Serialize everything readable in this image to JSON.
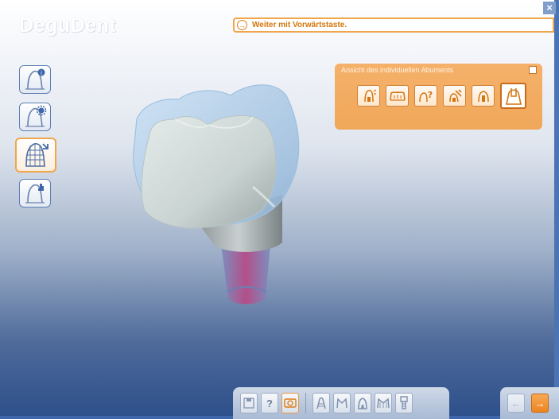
{
  "app": {
    "logo_text": "DeguDent",
    "close_glyph": "×"
  },
  "message": {
    "arrow_glyph": "→",
    "text": "Weiter mit Vorwärtstaste."
  },
  "sidebar": {
    "items": [
      {
        "name": "tooth-info",
        "icon": "tooth-info-icon",
        "active": false
      },
      {
        "name": "tooth-settings",
        "icon": "tooth-gear-icon",
        "active": false
      },
      {
        "name": "tooth-mesh",
        "icon": "tooth-mesh-icon",
        "active": true
      },
      {
        "name": "tooth-edit",
        "icon": "tooth-hand-icon",
        "active": false
      }
    ]
  },
  "view_panel": {
    "title": "Ansicht des individuellen Abuments",
    "buttons": [
      {
        "icon": "abutment-side-icon"
      },
      {
        "icon": "jaw-icon"
      },
      {
        "icon": "abutment-question-icon"
      },
      {
        "icon": "abutment-tool-icon"
      },
      {
        "icon": "abutment-front-icon"
      },
      {
        "icon": "abutment-individual-icon",
        "active": true
      }
    ]
  },
  "toolbar": {
    "buttons": [
      {
        "name": "save",
        "icon": "save-icon",
        "glyph": ""
      },
      {
        "name": "help",
        "icon": "help-icon",
        "glyph": "?"
      },
      {
        "name": "screenshot",
        "icon": "camera-icon",
        "glyph": ""
      },
      {
        "name": "view-a",
        "icon": "tooth-a-icon",
        "glyph": ""
      },
      {
        "name": "view-m",
        "icon": "tooth-m-icon",
        "glyph": ""
      },
      {
        "name": "view-crown",
        "icon": "tooth-crown-icon",
        "glyph": ""
      },
      {
        "name": "view-m-mesh",
        "icon": "tooth-m-mesh-icon",
        "glyph": ""
      },
      {
        "name": "view-implant",
        "icon": "implant-icon",
        "glyph": ""
      }
    ]
  },
  "nav": {
    "back_glyph": "←",
    "forward_glyph": "→"
  },
  "colors": {
    "accent": "#f0a64c",
    "frame": "#4b74b4",
    "implant": "#b64b86"
  }
}
